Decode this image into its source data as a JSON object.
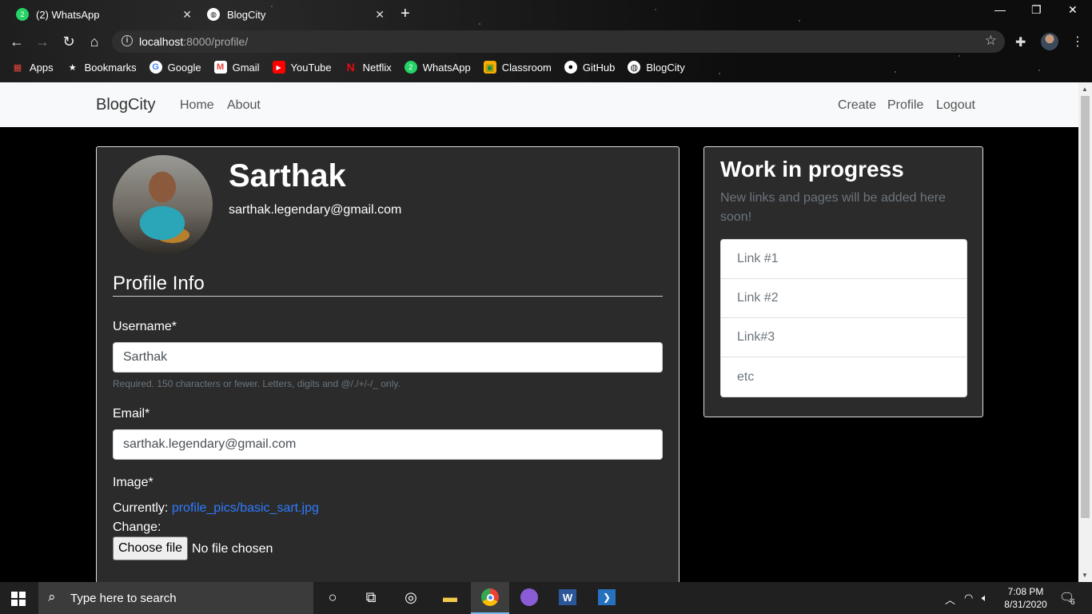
{
  "browser": {
    "tabs": [
      {
        "title": "(2) WhatsApp",
        "close": "✕"
      },
      {
        "title": "BlogCity",
        "close": "✕"
      }
    ],
    "new_tab": "+",
    "window_controls": {
      "minimize": "—",
      "maximize": "❐",
      "close": "✕"
    },
    "url_host": "localhost",
    "url_rest": ":8000/profile/",
    "bookmarks": [
      {
        "label": "Apps",
        "icon": "apps-grid-icon",
        "color": "#e8453c"
      },
      {
        "label": "Bookmarks",
        "icon": "star-icon",
        "color": "#ffffff"
      },
      {
        "label": "Google",
        "icon": "google-icon",
        "color": "#4285f4"
      },
      {
        "label": "Gmail",
        "icon": "gmail-icon",
        "color": "#ea4335"
      },
      {
        "label": "YouTube",
        "icon": "youtube-icon",
        "color": "#ff0000"
      },
      {
        "label": "Netflix",
        "icon": "netflix-icon",
        "color": "#e50914"
      },
      {
        "label": "WhatsApp",
        "icon": "whatsapp-icon",
        "color": "#25d366"
      },
      {
        "label": "Classroom",
        "icon": "classroom-icon",
        "color": "#1e8e3e"
      },
      {
        "label": "GitHub",
        "icon": "github-icon",
        "color": "#ffffff"
      },
      {
        "label": "BlogCity",
        "icon": "globe-icon",
        "color": "#ffffff"
      }
    ]
  },
  "site": {
    "brand": "BlogCity",
    "nav_left": [
      "Home",
      "About"
    ],
    "nav_right": [
      "Create",
      "Profile",
      "Logout"
    ]
  },
  "profile": {
    "username_heading": "Sarthak",
    "email_text": "sarthak.legendary@gmail.com",
    "section_title": "Profile Info",
    "username_label": "Username*",
    "username_value": "Sarthak",
    "username_help": "Required. 150 characters or fewer. Letters, digits and @/./+/-/_ only.",
    "email_label": "Email*",
    "email_value": "sarthak.legendary@gmail.com",
    "image_label": "Image*",
    "currently_label": "Currently:",
    "currently_link": "profile_pics/basic_sart.jpg",
    "change_label": "Change:",
    "choose_file": "Choose file",
    "no_file": "No file chosen"
  },
  "sidebar": {
    "title": "Work in progress",
    "subtitle": "New links and pages will be added here soon!",
    "links": [
      "Link #1",
      "Link #2",
      "Link#3",
      "etc"
    ]
  },
  "taskbar": {
    "search_placeholder": "Type here to search",
    "time": "7:08 PM",
    "date": "8/31/2020",
    "notifications": "6"
  },
  "colors": {
    "link_blue": "#2f7bff",
    "card_bg": "#2b2b2b",
    "navbar_bg": "#f8f9fa"
  }
}
